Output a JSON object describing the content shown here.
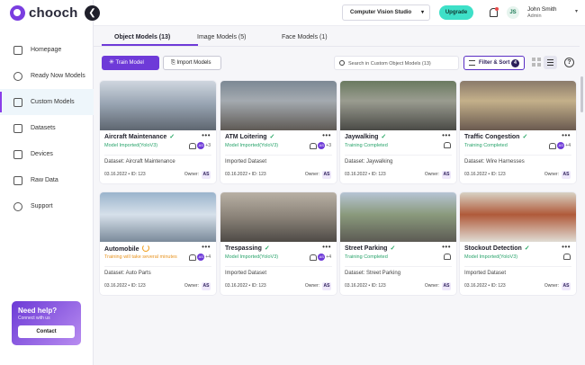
{
  "brand": {
    "name": "chooch"
  },
  "sidebar": {
    "items": [
      {
        "label": "Homepage",
        "icon": "home-icon"
      },
      {
        "label": "Ready Now Models",
        "icon": "eye-icon"
      },
      {
        "label": "Custom Models",
        "icon": "target-icon",
        "active": true
      },
      {
        "label": "Datasets",
        "icon": "stack-icon"
      },
      {
        "label": "Devices",
        "icon": "device-icon"
      },
      {
        "label": "Raw Data",
        "icon": "database-icon"
      },
      {
        "label": "Support",
        "icon": "support-icon"
      }
    ],
    "help": {
      "title": "Need help?",
      "subtitle": "Connect with us",
      "button": "Contact"
    }
  },
  "topbar": {
    "studio": "Computer Vision Studio",
    "upgrade": "Upgrade",
    "user": {
      "initials": "JS",
      "name": "John Smith",
      "role": "Admin"
    }
  },
  "tabs": [
    {
      "label": "Object Models (13)",
      "active": true
    },
    {
      "label": "Image Models (5)",
      "active": false
    },
    {
      "label": "Face Models (1)",
      "active": false
    }
  ],
  "toolbar": {
    "train": "Train Model",
    "import": "Import Models",
    "search_placeholder": "Search in Custom Object Models (13)",
    "filter": "Filter & Sort",
    "filter_count": "4"
  },
  "cards": [
    {
      "title": "Aircraft Maintenance",
      "state": "check",
      "status": "Model Imported(YoloV3)",
      "status_type": "ok",
      "users": "+3",
      "dataset": "Dataset: Aircraft Maintenance",
      "date": "03.16.2022",
      "id": "ID: 123",
      "owner": "Owner:",
      "owner_initials": "AS"
    },
    {
      "title": "ATM Loitering",
      "state": "check",
      "status": "Model Imported(YoloV3)",
      "status_type": "ok",
      "users": "+3",
      "dataset": "Imported Dataset",
      "date": "03.16.2022",
      "id": "ID: 123",
      "owner": "Owner:",
      "owner_initials": "AS"
    },
    {
      "title": "Jaywalking",
      "state": "check",
      "status": "Training Completed",
      "status_type": "ok",
      "users": "",
      "dataset": "Dataset: Jaywalking",
      "date": "03.16.2022",
      "id": "ID: 123",
      "owner": "Owner:",
      "owner_initials": "AS"
    },
    {
      "title": "Traffic Congestion",
      "state": "check",
      "status": "Training Completed",
      "status_type": "ok",
      "users": "+4",
      "dataset": "Dataset: Wire Harnesses",
      "date": "03.16.2022",
      "id": "ID: 123",
      "owner": "Owner:",
      "owner_initials": "AS"
    },
    {
      "title": "Automobile",
      "state": "spin",
      "status": "Training will take several minutes",
      "status_type": "warn",
      "users": "+4",
      "dataset": "Dataset: Auto Parts",
      "date": "03.16.2022",
      "id": "ID: 123",
      "owner": "Owner:",
      "owner_initials": "AS"
    },
    {
      "title": "Trespassing",
      "state": "check",
      "status": "Model Imported(YoloV3)",
      "status_type": "ok",
      "users": "+4",
      "dataset": "Imported Dataset",
      "date": "03.16.2022",
      "id": "ID: 123",
      "owner": "Owner:",
      "owner_initials": "AS"
    },
    {
      "title": "Street Parking",
      "state": "check",
      "status": "Training Completed",
      "status_type": "ok",
      "users": "",
      "dataset": "Dataset: Street Parking",
      "date": "03.16.2022",
      "id": "ID: 123",
      "owner": "Owner:",
      "owner_initials": "AS"
    },
    {
      "title": "Stockout Detection",
      "state": "check",
      "status": "Model Imported(YoloV3)",
      "status_type": "ok",
      "users": "",
      "dataset": "Imported Dataset",
      "date": "03.16.2022",
      "id": "ID: 123",
      "owner": "Owner:",
      "owner_initials": "AS"
    }
  ],
  "colors": {
    "accent": "#6e3ad8",
    "upgrade": "#3ee0c8",
    "ok": "#27a36a",
    "warn": "#e89420"
  }
}
